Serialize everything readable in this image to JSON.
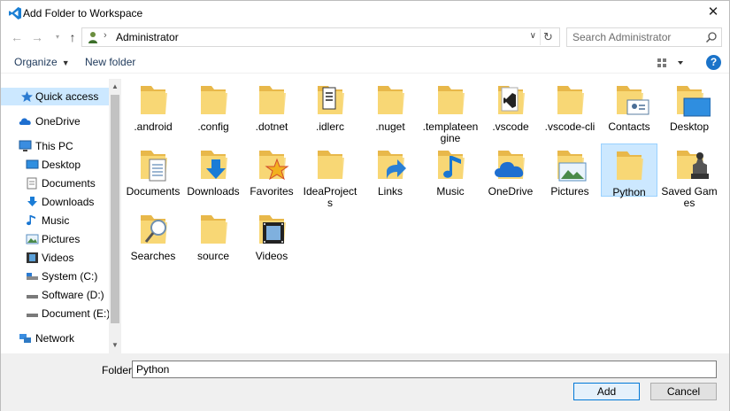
{
  "window": {
    "title": "Add Folder to Workspace"
  },
  "address": {
    "path": "Administrator"
  },
  "search": {
    "placeholder": "Search Administrator"
  },
  "toolbar": {
    "organize": "Organize",
    "new_folder": "New folder"
  },
  "nav": {
    "items": [
      {
        "label": "Quick access",
        "icon": "star-icon",
        "selected": true
      },
      {
        "label": "OneDrive",
        "icon": "cloud-icon"
      },
      {
        "label": "This PC",
        "icon": "computer-icon"
      },
      {
        "label": "Desktop",
        "icon": "desktop-icon"
      },
      {
        "label": "Documents",
        "icon": "documents-icon"
      },
      {
        "label": "Downloads",
        "icon": "download-icon"
      },
      {
        "label": "Music",
        "icon": "music-icon"
      },
      {
        "label": "Pictures",
        "icon": "pictures-icon"
      },
      {
        "label": "Videos",
        "icon": "videos-icon"
      },
      {
        "label": "System (C:)",
        "icon": "drive-icon"
      },
      {
        "label": "Software (D:)",
        "icon": "drive-icon"
      },
      {
        "label": "Document (E:)",
        "icon": "drive-icon"
      },
      {
        "label": "Network",
        "icon": "network-icon"
      }
    ]
  },
  "items": [
    {
      "name": ".android",
      "overlay": "none"
    },
    {
      "name": ".config",
      "overlay": "none"
    },
    {
      "name": ".dotnet",
      "overlay": "none"
    },
    {
      "name": ".idlerc",
      "overlay": "document"
    },
    {
      "name": ".nuget",
      "overlay": "none"
    },
    {
      "name": ".templateengine",
      "overlay": "none"
    },
    {
      "name": ".vscode",
      "overlay": "vscode"
    },
    {
      "name": ".vscode-cli",
      "overlay": "none"
    },
    {
      "name": "Contacts",
      "overlay": "contacts"
    },
    {
      "name": "Desktop",
      "overlay": "desktop"
    },
    {
      "name": "Documents",
      "overlay": "documents"
    },
    {
      "name": "Downloads",
      "overlay": "downloads"
    },
    {
      "name": "Favorites",
      "overlay": "star"
    },
    {
      "name": "IdeaProjects",
      "overlay": "none"
    },
    {
      "name": "Links",
      "overlay": "links"
    },
    {
      "name": "Music",
      "overlay": "music"
    },
    {
      "name": "OneDrive",
      "overlay": "cloud"
    },
    {
      "name": "Pictures",
      "overlay": "pictures"
    },
    {
      "name": "Python",
      "overlay": "none",
      "selected": true
    },
    {
      "name": "Saved Games",
      "overlay": "games"
    },
    {
      "name": "Searches",
      "overlay": "search"
    },
    {
      "name": "source",
      "overlay": "none"
    },
    {
      "name": "Videos",
      "overlay": "film"
    }
  ],
  "footer": {
    "folder_label": "Folder:",
    "folder_value": "Python",
    "add_label": "Add",
    "cancel_label": "Cancel"
  },
  "colors": {
    "accent": "#0078d7",
    "selection": "#cce8ff",
    "folder": "#f8d775",
    "folder_dark": "#e8b84a"
  }
}
